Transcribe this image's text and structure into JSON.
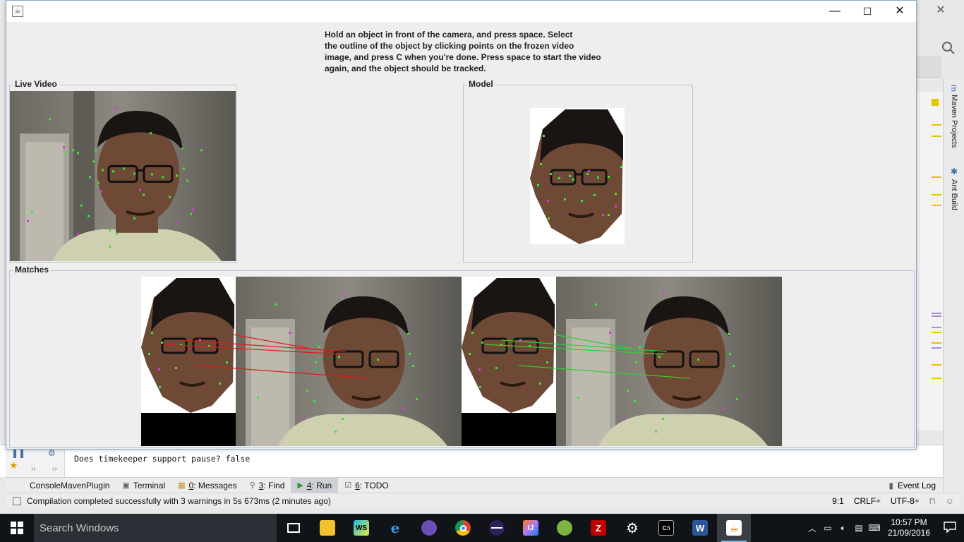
{
  "java_window": {
    "instructions": [
      "Hold an object in front of the camera, and press space. Select",
      "the outline of the object by clicking points on the frozen video",
      "image, and press C when you're done. Press space to start the video",
      "again, and the object should be tracked."
    ],
    "panels": {
      "live_video": "Live Video",
      "model": "Model",
      "matches": "Matches"
    },
    "controls": {
      "minimize": "—",
      "maximize": "☐",
      "close": "✕"
    }
  },
  "ide": {
    "side_tabs": {
      "maven": "Maven Projects",
      "ant": "Ant Build"
    },
    "console_line": "Does timekeeper support pause? false",
    "tool_tabs": [
      {
        "icon": "",
        "pre": "",
        "num": "",
        "label": "ConsoleMavenPlugin"
      },
      {
        "icon": "▣",
        "pre": "",
        "num": "",
        "label": "Terminal"
      },
      {
        "icon": "▦",
        "pre": "",
        "num": "0",
        "label": ": Messages"
      },
      {
        "icon": "⚲",
        "pre": "",
        "num": "3",
        "label": ": Find"
      },
      {
        "icon": "▶",
        "pre": "",
        "num": "4",
        "label": ": Run"
      },
      {
        "icon": "☑",
        "pre": "",
        "num": "6",
        "label": ": TODO"
      }
    ],
    "event_log": "Event Log",
    "status_message": "Compilation completed successfully with 3 warnings in 5s 673ms (2 minutes ago)",
    "status_position": "9:1",
    "status_line_sep": "CRLF÷",
    "status_encoding": "UTF-8÷"
  },
  "taskbar": {
    "search_placeholder": "Search Windows",
    "apps": [
      "task-view",
      "file-explorer",
      "webstorm",
      "edge",
      "github-desktop",
      "chrome",
      "eclipse",
      "intellij",
      "android-studio",
      "filezilla",
      "settings",
      "command-prompt",
      "word",
      "java"
    ],
    "time": "10:57 PM",
    "date": "21/09/2016"
  }
}
